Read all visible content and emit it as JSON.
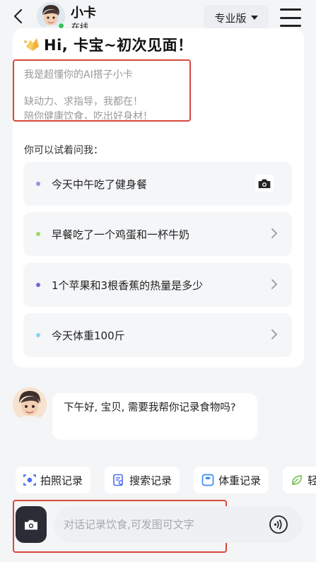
{
  "header": {
    "name": "小卡",
    "status": "在线",
    "plan_label": "专业版"
  },
  "welcome": {
    "greeting": "Hi, 卡宝~初次见面！",
    "intro_lines": [
      "我是超懂你的AI搭子小卡",
      "缺动力、求指导，我都在！",
      "陪你健康饮食，吃出好身材！"
    ],
    "try_label": "你可以试着问我：",
    "suggestions": [
      {
        "text": "今天中午吃了健身餐",
        "dot_color": "#9b8fe3",
        "action": "camera-icon"
      },
      {
        "text": "早餐吃了一个鸡蛋和一杯牛奶",
        "dot_color": "#9fd86a",
        "action": "chevron-right-icon"
      },
      {
        "text": "1个苹果和3根香蕉的热量是多少",
        "dot_color": "#6d6ad8",
        "action": "chevron-right-icon"
      },
      {
        "text": "今天体重100斤",
        "dot_color": "#8fd0f2",
        "action": "chevron-right-icon"
      }
    ]
  },
  "chat": {
    "bot_message": "下午好, 宝贝, 需要我帮你记录食物吗?"
  },
  "quick_actions": [
    {
      "label": "拍照记录",
      "icon": "scan-camera-icon",
      "color": "#4f6cf2"
    },
    {
      "label": "搜索记录",
      "icon": "search-doc-icon",
      "color": "#4f6cf2"
    },
    {
      "label": "体重记录",
      "icon": "scale-icon",
      "color": "#3b8df0"
    },
    {
      "label": "轻断",
      "icon": "leaf-icon",
      "color": "#7cc35a"
    }
  ],
  "input": {
    "placeholder": "对话记录饮食,可发图可文字"
  },
  "colors": {
    "accent_red": "#d9483b",
    "dark_button": "#2a2d35",
    "online_green": "#35c55c"
  }
}
